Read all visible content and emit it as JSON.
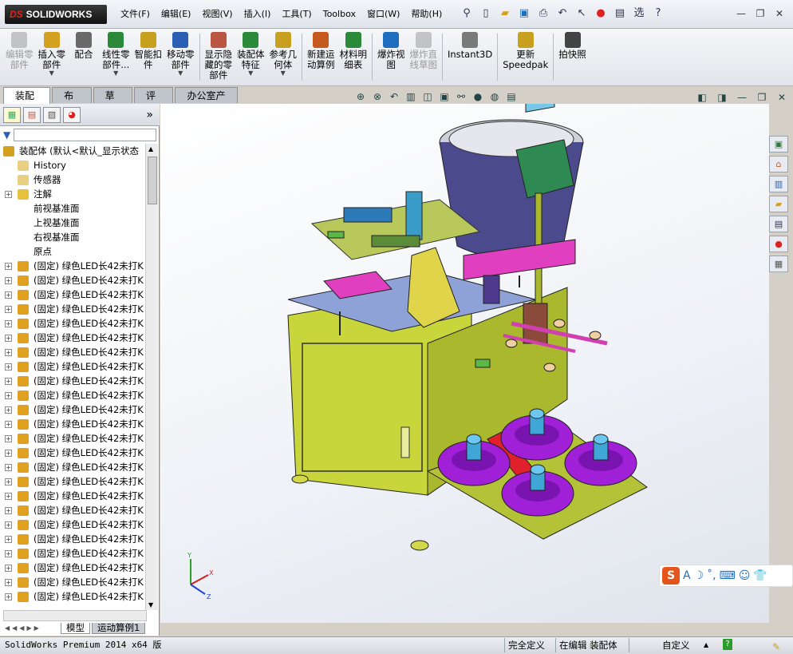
{
  "app": {
    "title": "SOLIDWORKS",
    "brand": "DS"
  },
  "menu": [
    "文件(F)",
    "编辑(E)",
    "视图(V)",
    "插入(I)",
    "工具(T)",
    "Toolbox",
    "窗口(W)",
    "帮助(H)"
  ],
  "quick_access": [
    "pin-icon",
    "new-document-icon",
    "open-folder-icon",
    "save-icon",
    "print-icon",
    "undo-icon",
    "select-arrow-icon",
    "rebuild-traffic-light-icon",
    "file-properties-icon",
    "options-icon",
    "help-icon"
  ],
  "quick_extra": "选",
  "command_buttons": [
    {
      "label": "编辑零\n部件",
      "icon": "edit-component-icon",
      "disabled": true
    },
    {
      "label": "插入零\n部件",
      "icon": "insert-component-icon",
      "disabled": false,
      "dropdown": true
    },
    {
      "label": "配合",
      "icon": "mate-icon",
      "disabled": false
    },
    {
      "label": "线性零\n部件...",
      "icon": "linear-pattern-icon",
      "disabled": false,
      "dropdown": true
    },
    {
      "label": "智能扣\n件",
      "icon": "smart-fasteners-icon",
      "disabled": false
    },
    {
      "label": "移动零\n部件",
      "icon": "move-component-icon",
      "disabled": false,
      "dropdown": true
    },
    {
      "label": "显示隐\n藏的零\n部件",
      "icon": "show-hidden-icon",
      "disabled": false
    },
    {
      "label": "装配体\n特征",
      "icon": "assembly-features-icon",
      "disabled": false,
      "dropdown": true
    },
    {
      "label": "参考几\n何体",
      "icon": "reference-geometry-icon",
      "disabled": false,
      "dropdown": true
    },
    {
      "label": "新建运\n动算例",
      "icon": "new-motion-study-icon",
      "disabled": false
    },
    {
      "label": "材料明\n细表",
      "icon": "bom-icon",
      "disabled": false
    },
    {
      "label": "爆炸视\n图",
      "icon": "exploded-view-icon",
      "disabled": false
    },
    {
      "label": "爆炸直\n线草图",
      "icon": "explode-line-sketch-icon",
      "disabled": true
    },
    {
      "label": "Instant3D",
      "icon": "instant3d-icon",
      "disabled": false
    },
    {
      "label": "更新\nSpeedpak",
      "icon": "speedpak-icon",
      "disabled": false
    },
    {
      "label": "拍快照",
      "icon": "snapshot-icon",
      "disabled": false
    }
  ],
  "tabs": [
    "装配体",
    "布局",
    "草图",
    "评估",
    "办公室产品"
  ],
  "left_tabs": [
    "featuremanager-icon",
    "propertymanager-icon",
    "configurationmanager-icon",
    "displaymanager-icon"
  ],
  "left_collapse": "»",
  "tree": {
    "root": "装配体  (默认<默认_显示状态",
    "items": [
      {
        "label": "History",
        "icon": "history-icon"
      },
      {
        "label": "传感器",
        "icon": "sensor-icon"
      },
      {
        "label": "注解",
        "icon": "annotation-icon",
        "expandable": true
      },
      {
        "label": "前视基准面",
        "icon": "plane-icon"
      },
      {
        "label": "上视基准面",
        "icon": "plane-icon"
      },
      {
        "label": "右视基准面",
        "icon": "plane-icon"
      },
      {
        "label": "原点",
        "icon": "origin-icon"
      }
    ],
    "part_label": "(固定) 绿色LED长42未打K",
    "part_count": 24
  },
  "bottom_tabs": [
    "模型",
    "运动算例1"
  ],
  "status": {
    "product": "SolidWorks Premium 2014 x64 版",
    "definition": "完全定义",
    "editing": "在编辑 装配体",
    "units": "自定义"
  },
  "ime": {
    "letter": "S",
    "items": [
      "A",
      "moon",
      "dots",
      "keyboard",
      "user",
      "shirt"
    ]
  },
  "colors": {
    "accent": "#1e6ebf",
    "brand_red": "#e2231a",
    "olive": "#c8d63c",
    "purple": "#a020d8",
    "magenta": "#e040c0"
  }
}
